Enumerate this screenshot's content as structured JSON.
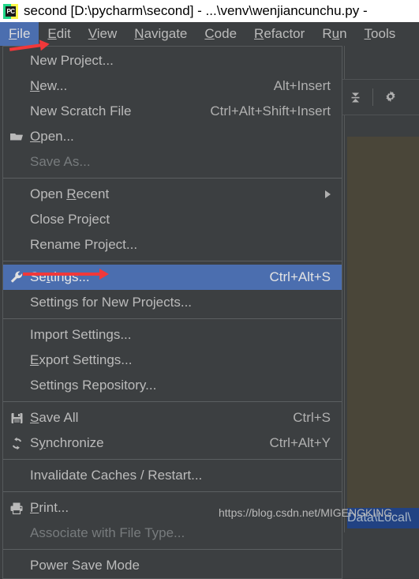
{
  "window": {
    "title": "second [D:\\pycharm\\second] - ...\\venv\\wenjiancunchu.py -",
    "app_icon_text": "PC"
  },
  "menubar": {
    "items": [
      {
        "label": "File",
        "mnemonic": "F",
        "active": true
      },
      {
        "label": "Edit",
        "mnemonic": "E",
        "active": false
      },
      {
        "label": "View",
        "mnemonic": "V",
        "active": false
      },
      {
        "label": "Navigate",
        "mnemonic": "N",
        "active": false
      },
      {
        "label": "Code",
        "mnemonic": "C",
        "active": false
      },
      {
        "label": "Refactor",
        "mnemonic": "R",
        "active": false
      },
      {
        "label": "Run",
        "mnemonic": "u",
        "active": false
      },
      {
        "label": "Tools",
        "mnemonic": "T",
        "active": false
      }
    ]
  },
  "file_menu": {
    "items": [
      {
        "label": "New Project...",
        "accel": "",
        "icon": "",
        "selected": false,
        "disabled": false,
        "submenu": false
      },
      {
        "label": "New...",
        "accel": "Alt+Insert",
        "icon": "",
        "selected": false,
        "disabled": false,
        "submenu": false
      },
      {
        "label": "New Scratch File",
        "accel": "Ctrl+Alt+Shift+Insert",
        "icon": "",
        "selected": false,
        "disabled": false,
        "submenu": false
      },
      {
        "label": "Open...",
        "accel": "",
        "icon": "folder-icon",
        "selected": false,
        "disabled": false,
        "submenu": false
      },
      {
        "label": "Save As...",
        "accel": "",
        "icon": "",
        "selected": false,
        "disabled": true,
        "submenu": false
      },
      {
        "label": "Open Recent",
        "accel": "",
        "icon": "",
        "selected": false,
        "disabled": false,
        "submenu": true
      },
      {
        "label": "Close Project",
        "accel": "",
        "icon": "",
        "selected": false,
        "disabled": false,
        "submenu": false
      },
      {
        "label": "Rename Project...",
        "accel": "",
        "icon": "",
        "selected": false,
        "disabled": false,
        "submenu": false
      },
      {
        "label": "Settings...",
        "accel": "Ctrl+Alt+S",
        "icon": "wrench-icon",
        "selected": true,
        "disabled": false,
        "submenu": false
      },
      {
        "label": "Settings for New Projects...",
        "accel": "",
        "icon": "",
        "selected": false,
        "disabled": false,
        "submenu": false
      },
      {
        "label": "Import Settings...",
        "accel": "",
        "icon": "",
        "selected": false,
        "disabled": false,
        "submenu": false
      },
      {
        "label": "Export Settings...",
        "accel": "",
        "icon": "",
        "selected": false,
        "disabled": false,
        "submenu": false
      },
      {
        "label": "Settings Repository...",
        "accel": "",
        "icon": "",
        "selected": false,
        "disabled": false,
        "submenu": false
      },
      {
        "label": "Save All",
        "accel": "Ctrl+S",
        "icon": "save-icon",
        "selected": false,
        "disabled": false,
        "submenu": false
      },
      {
        "label": "Synchronize",
        "accel": "Ctrl+Alt+Y",
        "icon": "sync-icon",
        "selected": false,
        "disabled": false,
        "submenu": false
      },
      {
        "label": "Invalidate Caches / Restart...",
        "accel": "",
        "icon": "",
        "selected": false,
        "disabled": false,
        "submenu": false
      },
      {
        "label": "Print...",
        "accel": "",
        "icon": "print-icon",
        "selected": false,
        "disabled": false,
        "submenu": false
      },
      {
        "label": "Associate with File Type...",
        "accel": "",
        "icon": "",
        "selected": false,
        "disabled": true,
        "submenu": false
      },
      {
        "label": "Power Save Mode",
        "accel": "",
        "icon": "",
        "selected": false,
        "disabled": false,
        "submenu": false
      }
    ]
  },
  "background": {
    "toolbar_icons": [
      "collapse-all-icon",
      "settings-gear-icon"
    ],
    "selected_text": "Data\\Local\\"
  },
  "watermark": {
    "text": "https://blog.csdn.net/MIGENGKING"
  },
  "annotations": {
    "arrow_file": "red-arrow-pointing-to-file-menu",
    "arrow_settings": "red-arrow-pointing-to-settings-item"
  },
  "colors": {
    "menu_background": "#3c3f41",
    "menu_highlight": "#4b6eaf",
    "menu_text": "#bbbbbb",
    "menu_disabled_text": "#777b7d",
    "titlebar_background": "#ffffff",
    "editor_olive": "#4a4639",
    "editor_selection": "#214283",
    "annotation_red": "#f1383a"
  }
}
